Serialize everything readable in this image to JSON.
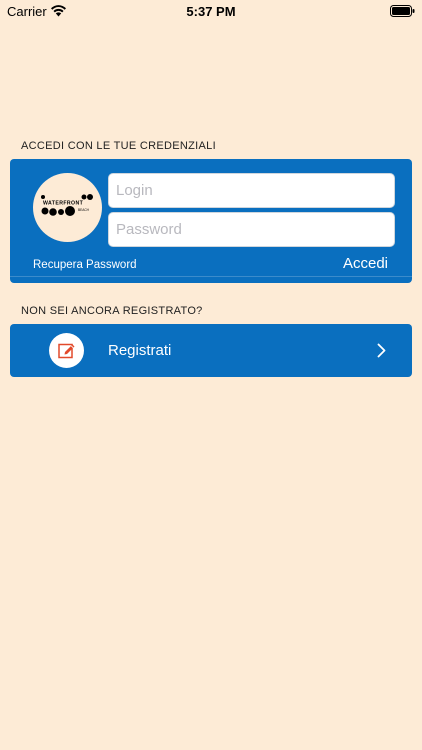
{
  "status_bar": {
    "carrier": "Carrier",
    "time": "5:37 PM",
    "icons": [
      "wifi-icon",
      "battery-icon"
    ]
  },
  "login_section": {
    "heading": "ACCEDI CON LE TUE CREDENZIALI",
    "logo_alt": "WATERFRONT BEACH logo",
    "login_placeholder": "Login",
    "login_value": "",
    "password_placeholder": "Password",
    "password_value": "",
    "recover_label": "Recupera Password",
    "submit_label": "Accedi"
  },
  "register_section": {
    "heading": "NON SEI ANCORA REGISTRATO?",
    "button_label": "Registrati",
    "icon": "edit-note-icon",
    "chevron_icon": "chevron-right-icon"
  },
  "colors": {
    "background": "#FDEBD6",
    "card": "#0A6FBF",
    "icon_accent": "#E24A2B"
  }
}
